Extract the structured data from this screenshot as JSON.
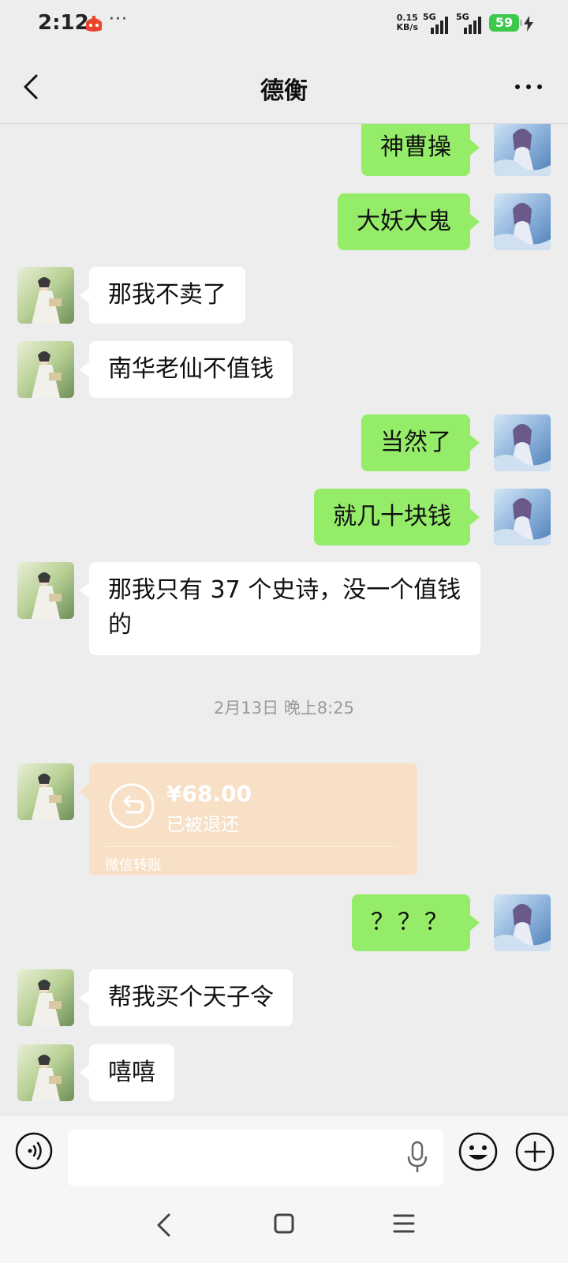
{
  "status_bar": {
    "time": "2:12",
    "more": "···",
    "speed_value": "0.15",
    "speed_unit": "KB/s",
    "sim1": "5G",
    "sim2": "5G",
    "battery": "59"
  },
  "header": {
    "title": "德衡"
  },
  "messages": [
    {
      "sender": "me",
      "text": "神曹操"
    },
    {
      "sender": "me",
      "text": "大妖大鬼"
    },
    {
      "sender": "other",
      "text": "那我不卖了"
    },
    {
      "sender": "other",
      "text": "南华老仙不值钱"
    },
    {
      "sender": "me",
      "text": "当然了"
    },
    {
      "sender": "me",
      "text": "就几十块钱"
    },
    {
      "sender": "other",
      "text": "那我只有 37 个史诗，没一个值钱的"
    },
    {
      "sender": "other",
      "text": "？？？"
    },
    {
      "sender": "other",
      "text": "帮我买个天子令"
    },
    {
      "sender": "other",
      "text": "嘻嘻"
    }
  ],
  "timestamp": "2月13日 晚上8:25",
  "transfer": {
    "amount": "¥68.00",
    "status": "已被退还",
    "label": "微信转账"
  },
  "input": {
    "placeholder": ""
  },
  "colors": {
    "my_bubble": "#95ec69",
    "other_bubble": "#ffffff",
    "transfer_card": "#f7e0c6",
    "background": "#ededed"
  },
  "icons": {
    "back": "chevron-left-icon",
    "more": "more-dots-icon",
    "voice": "voice-icon",
    "mic": "microphone-icon",
    "emoji": "emoji-icon",
    "plus": "plus-icon",
    "transfer": "refund-arrow-icon"
  }
}
